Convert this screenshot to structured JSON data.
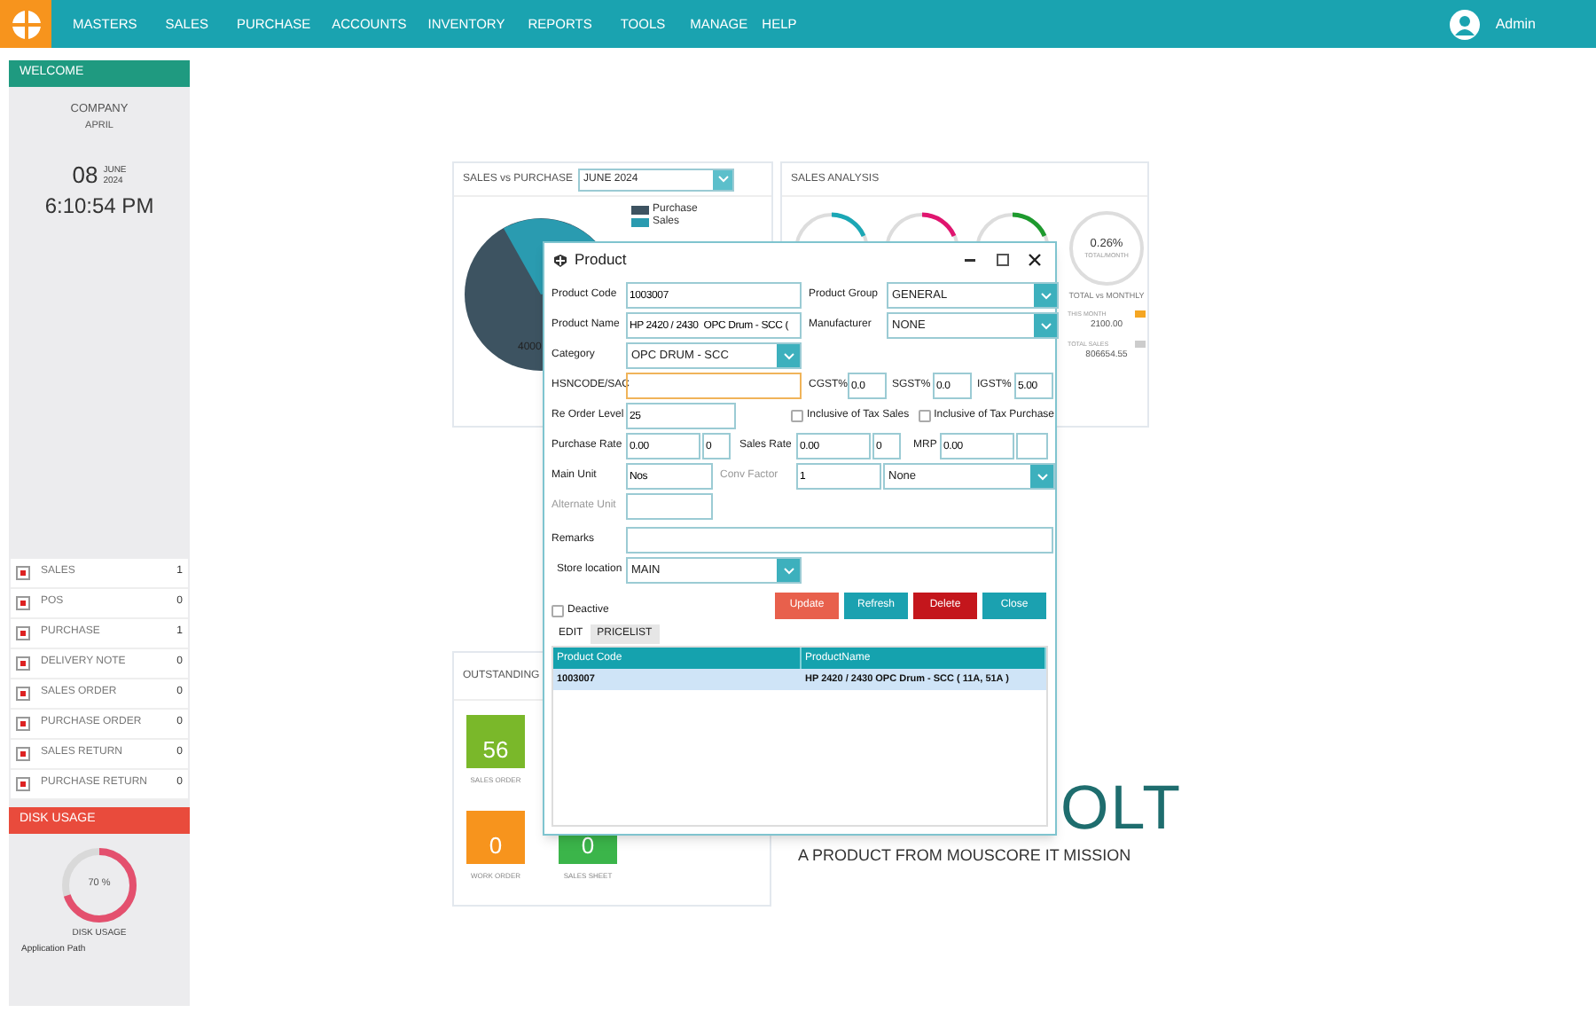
{
  "nav": {
    "menu": [
      "MASTERS",
      "SALES",
      "PURCHASE",
      "ACCOUNTS",
      "INVENTORY",
      "REPORTS",
      "TOOLS",
      "MANAGE",
      "HELP"
    ],
    "user": "Admin"
  },
  "sidebar": {
    "welcome": "WELCOME",
    "company": "COMPANY",
    "company_sub": "APRIL",
    "day": "08",
    "month": "JUNE",
    "year": "2024",
    "time": "6:10:54 PM",
    "items": [
      {
        "label": "SALES",
        "count": "1"
      },
      {
        "label": "POS",
        "count": "0"
      },
      {
        "label": "PURCHASE",
        "count": "1"
      },
      {
        "label": "DELIVERY NOTE",
        "count": "0"
      },
      {
        "label": "SALES ORDER",
        "count": "0"
      },
      {
        "label": "PURCHASE ORDER",
        "count": "0"
      },
      {
        "label": "SALES RETURN",
        "count": "0"
      },
      {
        "label": "PURCHASE RETURN",
        "count": "0"
      }
    ],
    "disk_title": "DISK USAGE",
    "disk": {
      "level": 0.7,
      "reading": "70 %",
      "caption": "DISK USAGE"
    },
    "app_path": "Application Path"
  },
  "sales_vs_purchase": {
    "title": "SALES vs PURCHASE",
    "period": "JUNE 2024",
    "legend": [
      {
        "label": "Purchase",
        "color": "#3d5361"
      },
      {
        "label": "Sales",
        "color": "#2a9bb0"
      }
    ],
    "slice_label": "4000"
  },
  "sales_analysis": {
    "title": "SALES ANALYSIS",
    "gauges": [
      {
        "color": "#1ba7b5"
      },
      {
        "color": "#e0156f"
      },
      {
        "color": "#1e9a2e"
      }
    ],
    "total_pct": "0.26%",
    "total_caption": "TOTAL/MONTH",
    "vs_caption": "TOTAL vs MONTHLY",
    "stats": [
      {
        "label": "THIS MONTH",
        "value": "2100.00",
        "color": "#f5a623"
      },
      {
        "label": "TOTAL SALES",
        "value": "806654.55",
        "color": "#cccccc"
      }
    ]
  },
  "outstanding": {
    "title": "OUTSTANDING",
    "tiles": [
      {
        "value": "56",
        "label": "SALES ORDER",
        "color": "#7ab82a"
      },
      {
        "value": "0",
        "label": "WORK ORDER",
        "color": "#f7941d"
      },
      {
        "value": "0",
        "label": "SALES SHEET",
        "color": "#3bb54a"
      }
    ]
  },
  "brand": {
    "logo_visible": "OLT",
    "tagline": "A PRODUCT FROM MOUSCORE IT MISSION"
  },
  "dialog": {
    "title": "Product",
    "product_code": {
      "label": "Product Code",
      "value": "1003007"
    },
    "product_group": {
      "label": "Product Group",
      "value": "GENERAL"
    },
    "product_name": {
      "label": "Product Name",
      "value": "HP 2420 / 2430  OPC Drum - SCC ("
    },
    "manufacturer": {
      "label": "Manufacturer",
      "value": "NONE"
    },
    "category": {
      "label": "Category",
      "value": "OPC DRUM  -  SCC"
    },
    "hsn": {
      "label": "HSNCODE/SAC",
      "focused": true
    },
    "cgst": {
      "label": "CGST%",
      "value": "0.0"
    },
    "sgst": {
      "label": "SGST%",
      "value": "0.0"
    },
    "igst": {
      "label": "IGST%",
      "value": "5.00"
    },
    "reorder_level": {
      "label": "Re Order Level",
      "value": "25"
    },
    "inclusive_tax_sales": {
      "label": "Inclusive of Tax Sales",
      "checked": false
    },
    "inclusive_tax_purchase": {
      "label": "Inclusive of Tax Purchase",
      "checked": false
    },
    "purchase_rate": {
      "label": "Purchase Rate",
      "value": "0.00",
      "value_2": "0"
    },
    "sales_rate": {
      "label": "Sales Rate",
      "value": "0.00",
      "value_2": "0"
    },
    "mrp": {
      "label": "MRP",
      "value": "0.00"
    },
    "main_unit": {
      "label": "Main Unit",
      "value": "Nos"
    },
    "conv_factor": {
      "label": "Conv Factor",
      "value": "1",
      "unit": "None",
      "disabled": true
    },
    "alternate_unit": {
      "label": "Alternate Unit",
      "disabled": true
    },
    "remarks": {
      "label": "Remarks"
    },
    "store_location": {
      "label": "Store location",
      "value": "MAIN"
    },
    "deactive": {
      "label": "Deactive",
      "checked": false
    },
    "buttons": [
      {
        "label": "Update",
        "color": "#e8604c"
      },
      {
        "label": "Refresh",
        "color": "#1ba1b0"
      },
      {
        "label": "Delete",
        "color": "#c4161c"
      },
      {
        "label": "Close",
        "color": "#1ba1b0"
      }
    ],
    "tabs": [
      {
        "label": "EDIT",
        "selected": true
      },
      {
        "label": "PRICELIST",
        "selected": false
      }
    ],
    "table": {
      "columns": [
        "Product Code",
        "ProductName"
      ],
      "rows": [
        {
          "cells": [
            "1003007",
            "HP 2420 / 2430  OPC Drum - SCC ( 11A, 51A )"
          ],
          "selected": true
        }
      ]
    }
  }
}
